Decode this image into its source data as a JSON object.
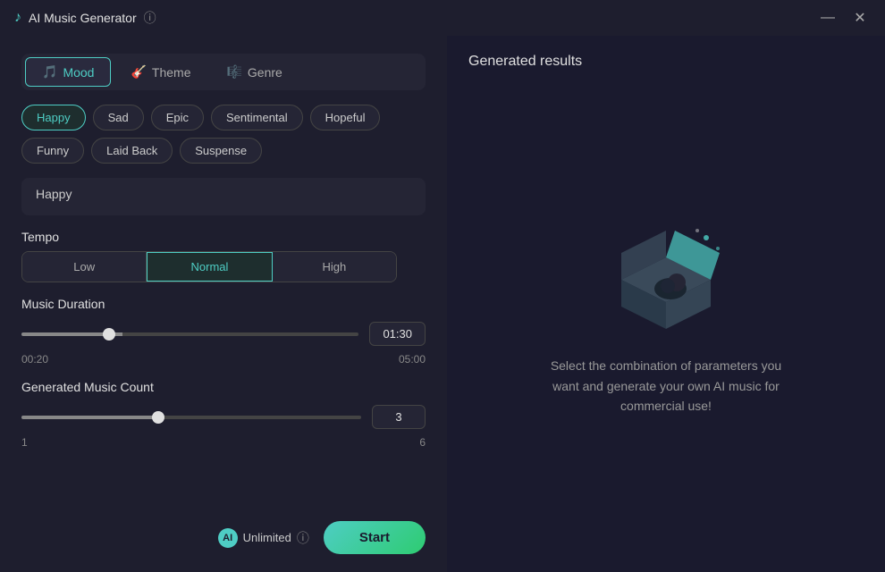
{
  "titleBar": {
    "appName": "AI Music Generator",
    "infoIcon": "ⓘ",
    "minimize": "—",
    "close": "✕"
  },
  "tabs": [
    {
      "id": "mood",
      "label": "Mood",
      "icon": "🎵",
      "active": true
    },
    {
      "id": "theme",
      "label": "Theme",
      "icon": "🎸",
      "active": false
    },
    {
      "id": "genre",
      "label": "Genre",
      "icon": "🎼",
      "active": false
    }
  ],
  "moods": [
    {
      "id": "happy",
      "label": "Happy",
      "selected": true
    },
    {
      "id": "sad",
      "label": "Sad",
      "selected": false
    },
    {
      "id": "epic",
      "label": "Epic",
      "selected": false
    },
    {
      "id": "sentimental",
      "label": "Sentimental",
      "selected": false
    },
    {
      "id": "hopeful",
      "label": "Hopeful",
      "selected": false
    },
    {
      "id": "funny",
      "label": "Funny",
      "selected": false
    },
    {
      "id": "laid-back",
      "label": "Laid Back",
      "selected": false
    },
    {
      "id": "suspense",
      "label": "Suspense",
      "selected": false
    }
  ],
  "selectedMoodDisplay": "Happy",
  "tempo": {
    "label": "Tempo",
    "options": [
      {
        "id": "low",
        "label": "Low",
        "active": false
      },
      {
        "id": "normal",
        "label": "Normal",
        "active": true
      },
      {
        "id": "high",
        "label": "High",
        "active": false
      }
    ]
  },
  "musicDuration": {
    "label": "Music Duration",
    "min": "00:20",
    "max": "05:00",
    "value": "01:30",
    "fillPct": "30%"
  },
  "generatedCount": {
    "label": "Generated Music Count",
    "min": "1",
    "max": "6",
    "value": "3",
    "fillPct": "40%"
  },
  "unlimited": {
    "label": "Unlimited",
    "icon": "AI"
  },
  "startButton": "Start",
  "results": {
    "title": "Generated results",
    "description": "Select the combination of parameters you want and generate your own AI music for commercial use!"
  }
}
